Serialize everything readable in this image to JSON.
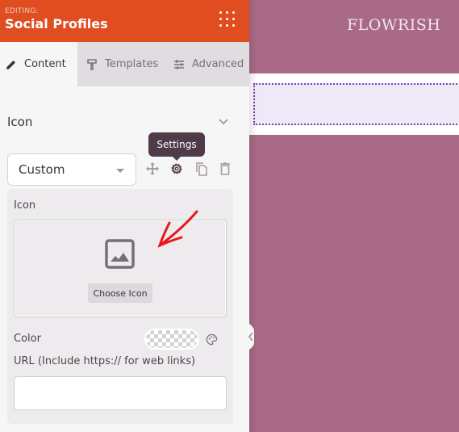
{
  "header": {
    "editing_label": "EDITING:",
    "title": "Social Profiles"
  },
  "tabs": [
    {
      "label": "Content",
      "icon": "pencil-icon",
      "active": true
    },
    {
      "label": "Templates",
      "icon": "paint-roller-icon",
      "active": false
    },
    {
      "label": "Advanced",
      "icon": "sliders-icon",
      "active": false
    }
  ],
  "section": {
    "title": "Icon",
    "expanded": true
  },
  "item": {
    "select_value": "Custom",
    "tooltip": "Settings",
    "actions": [
      "move-icon",
      "gear-icon",
      "copy-icon",
      "trash-icon"
    ]
  },
  "card": {
    "icon_label": "Icon",
    "choose_button": "Choose Icon",
    "color_label": "Color",
    "url_label": "URL (Include https:// for web links)",
    "url_value": "",
    "url_placeholder": ""
  },
  "preview": {
    "logo": "FLOWRISH"
  },
  "colors": {
    "header_bg": "#e04d21",
    "preview_bg": "#a96a88",
    "drop_zone_border": "#7b3fbf",
    "annotation_arrow": "#e8171b"
  }
}
